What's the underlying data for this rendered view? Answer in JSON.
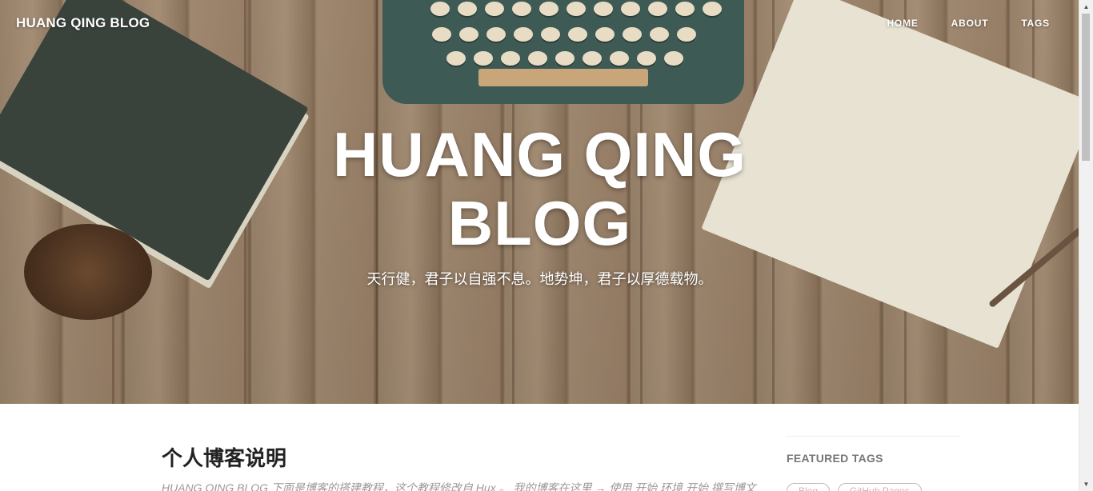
{
  "nav": {
    "brand": "HUANG QING BLOG",
    "links": [
      "HOME",
      "ABOUT",
      "TAGS"
    ]
  },
  "hero": {
    "title_line1": "HUANG QING",
    "title_line2": "BLOG",
    "subtitle": "天行健，君子以自强不息。地势坤，君子以厚德载物。"
  },
  "post": {
    "title": "个人博客说明",
    "excerpt": "HUANG QING BLOG 下面是博客的搭建教程，这个教程修改自 Hux 。 我的博客在这里 → 使用 开始 环境 开始 撰写博文"
  },
  "sidebar": {
    "featured_tags_title": "FEATURED TAGS",
    "tags": [
      "Blog",
      "GitHub Pages"
    ]
  },
  "colors": {
    "accent": "#ffffff",
    "text_dark": "#222222",
    "muted": "#999999"
  }
}
